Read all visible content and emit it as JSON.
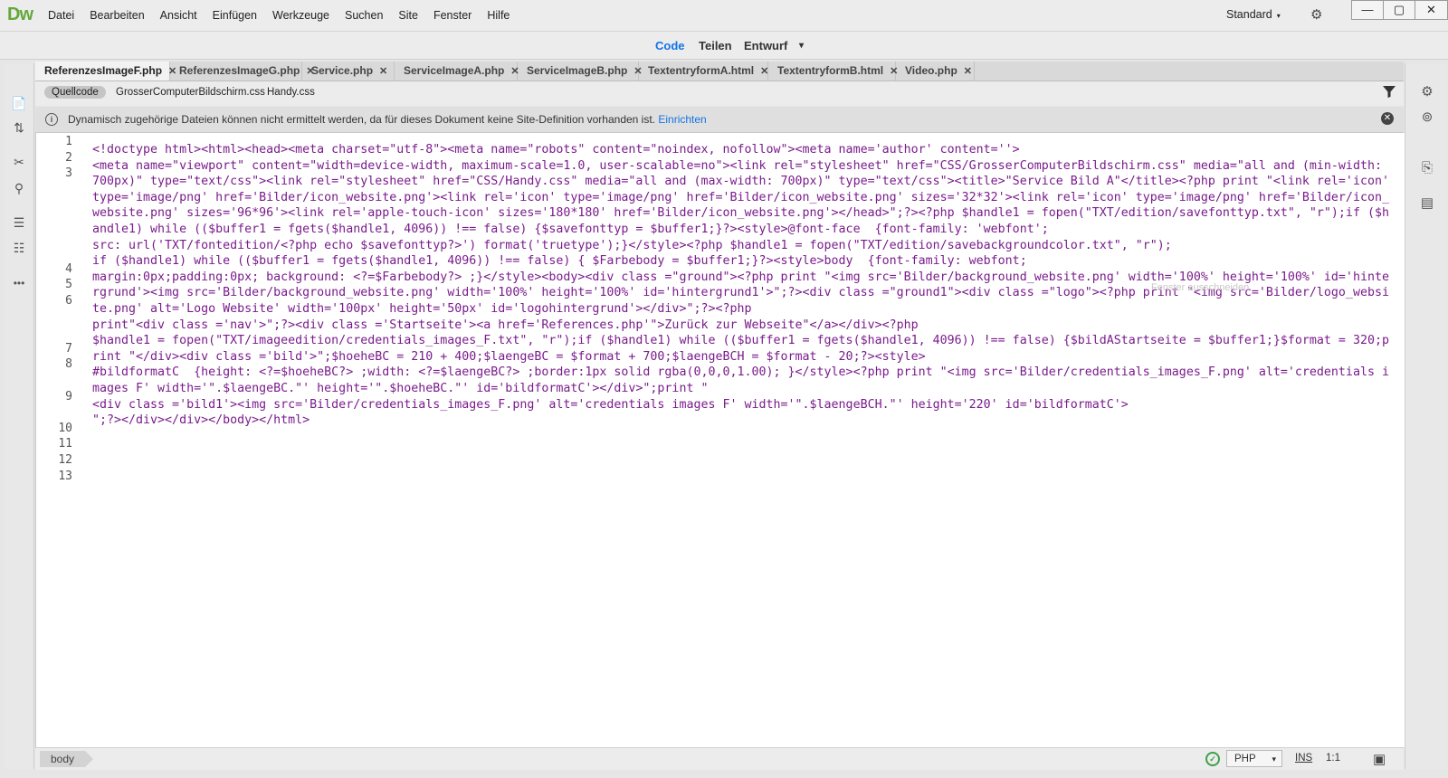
{
  "app": {
    "logo": "Dw"
  },
  "menu": [
    "Datei",
    "Bearbeiten",
    "Ansicht",
    "Einfügen",
    "Werkzeuge",
    "Suchen",
    "Site",
    "Fenster",
    "Hilfe"
  ],
  "titlebar": {
    "workspace": "Standard",
    "workspace_caret": "▾",
    "sync_icon": "⚙",
    "minimize": "—",
    "maximize": "▢",
    "close": "✕"
  },
  "view_switcher": {
    "code": "Code",
    "split": "Teilen",
    "design": "Entwurf",
    "caret": "▾"
  },
  "tabs": [
    {
      "label": "ReferenzesImageF.php",
      "active": true
    },
    {
      "label": "ReferenzesImageG.php"
    },
    {
      "label": "Service.php"
    },
    {
      "label": "ServiceImageA.php"
    },
    {
      "label": "ServiceImageB.php"
    },
    {
      "label": "TextentryformA.html"
    },
    {
      "label": "TextentryformB.html"
    },
    {
      "label": "Video.php"
    }
  ],
  "tab_close_glyph": "✕",
  "related_files": [
    "Quellcode",
    "GrosserComputerBildschirm.css",
    "Handy.css"
  ],
  "info": {
    "icon": "i",
    "text": "Dynamisch zugehörige Dateien können nicht ermittelt werden, da für dieses Dokument keine Site-Definition vorhanden ist.",
    "link": "Einrichten",
    "close": "✕"
  },
  "line_numbers": [
    "1",
    "2",
    "3",
    "4",
    "5",
    "6",
    "7",
    "8",
    "9",
    "10",
    "11",
    "12",
    "13"
  ],
  "code_text": "<!doctype html><html><head><meta charset=\"utf-8\"><meta name=\"robots\" content=\"noindex, nofollow\"><meta name='author' content=''>\n<meta name=\"viewport\" content=\"width=device-width, maximum-scale=1.0, user-scalable=no\"><link rel=\"stylesheet\" href=\"CSS/GrosserComputerBildschirm.css\" media=\"all and (min-width: 700px)\" type=\"text/css\"><link rel=\"stylesheet\" href=\"CSS/Handy.css\" media=\"all and (max-width: 700px)\" type=\"text/css\"><title>\"Service Bild A\"</title><?php print \"<link rel='icon' type='image/png' href='Bilder/icon_website.png'><link rel='icon' type='image/png' href='Bilder/icon_website.png' sizes='32*32'><link rel='icon' type='image/png' href='Bilder/icon_website.png' sizes='96*96'><link rel='apple-touch-icon' sizes='180*180' href='Bilder/icon_website.png'></head>\";?><?php $handle1 = fopen(\"TXT/edition/savefonttyp.txt\", \"r\");if ($handle1) while (($buffer1 = fgets($handle1, 4096)) !== false) {$savefonttyp = $buffer1;}?><style>@font-face  {font-family: 'webfont';\nsrc: url('TXT/fontedition/<?php echo $savefonttyp?>') format('truetype');}</style><?php $handle1 = fopen(\"TXT/edition/savebackgroundcolor.txt\", \"r\");\nif ($handle1) while (($buffer1 = fgets($handle1, 4096)) !== false) { $Farbebody = $buffer1;}?><style>body  {font-family: webfont;\nmargin:0px;padding:0px; background: <?=$Farbebody?> ;}</style><body><div class =\"ground\"><?php print \"<img src='Bilder/background_website.png' width='100%' height='100%' id='hintergrund'><img src='Bilder/background_website.png' width='100%' height='100%' id='hintergrund1'>\";?><div class =\"ground1\"><div class =\"logo\"><?php print \"<img src='Bilder/logo_website.png' alt='Logo Website' width='100px' height='50px' id='logohintergrund'></div>\";?><?php\nprint\"<div class ='nav'>\";?><div class ='Startseite'><a href='References.php'\">Zurück zur Webseite\"</a></div><?php\n$handle1 = fopen(\"TXT/imageedition/credentials_images_F.txt\", \"r\");if ($handle1) while (($buffer1 = fgets($handle1, 4096)) !== false) {$bildAStartseite = $buffer1;}$format = 320;print \"</div><div class ='bild'>\";$hoeheBC = 210 + 400;$laengeBC = $format + 700;$laengeBCH = $format - 20;?><style>\n#bildformatC  {height: <?=$hoeheBC?> ;width: <?=$laengeBC?> ;border:1px solid rgba(0,0,0,1.00); }</style><?php print \"<img src='Bilder/credentials_images_F.png' alt='credentials images F' width='\".$laengeBC.\"' height='\".$hoeheBC.\"' id='bildformatC'></div>\";print \"\n<div class ='bild1'><img src='Bilder/credentials_images_F.png' alt='credentials images F' width='\".$laengeBCH.\"' height='220' id='bildformatC'>\n\";?></div></div></body></html>",
  "ghost_tooltip": "Fenster ausschneiden",
  "status": {
    "breadcrumb": "body",
    "ok_icon": "✓",
    "language": "PHP",
    "language_caret": "▾",
    "insert_mode": "INS",
    "cursor": "1:1",
    "preview_icon": "▣"
  },
  "left_tools": [
    "📄",
    "⇅",
    "✂",
    "⚲",
    "☰",
    "☷",
    "•••"
  ],
  "right_tools": [
    "⚙",
    "⊚",
    "⎘",
    "▤"
  ]
}
